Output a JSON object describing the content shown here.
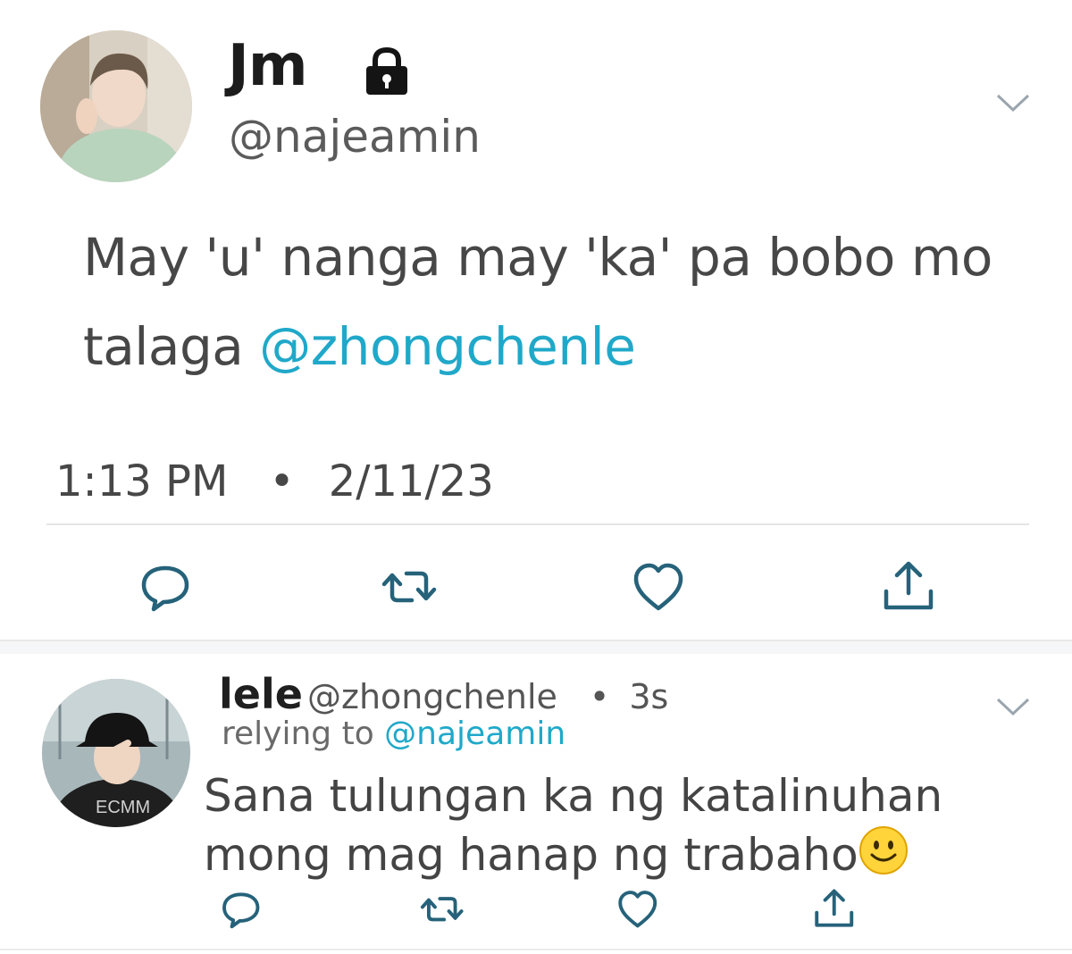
{
  "colors": {
    "accent": "#20a8c9",
    "icon": "#26627a",
    "text": "#474747",
    "divider": "#e5e5e5"
  },
  "main_tweet": {
    "display_name": "Jm",
    "handle": "@najeamin",
    "text_prefix": "May 'u' nanga may 'ka' pa bobo mo talaga ",
    "mention": "@zhongchenle",
    "time": "1:13 PM",
    "separator": "•",
    "date": "2/11/23",
    "icons": {
      "badge": "lock-icon",
      "menu": "chevron-down-icon",
      "actions": [
        "reply-icon",
        "retweet-icon",
        "like-icon",
        "share-icon"
      ]
    }
  },
  "reply_tweet": {
    "display_name": "lele",
    "handle": "@zhongchenle",
    "separator": "•",
    "time_ago": "3s",
    "replying_label": "relying to",
    "replying_to": "@najeamin",
    "text": "Sana tulungan ka ng katalinuhan mong mag hanap ng trabaho",
    "emoji": "slightly-smiling-face",
    "icons": {
      "menu": "chevron-down-icon",
      "actions": [
        "reply-icon",
        "retweet-icon",
        "like-icon",
        "share-icon"
      ]
    }
  }
}
